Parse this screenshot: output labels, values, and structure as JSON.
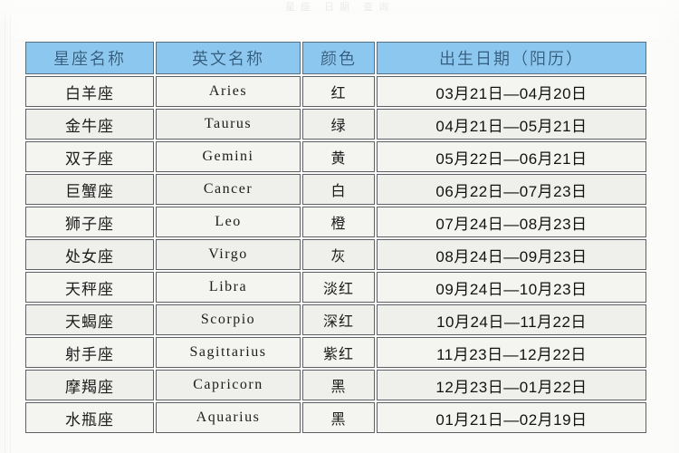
{
  "page": {
    "top_remnant_text": "星座  日期  查询",
    "header_bg_color": "#8cc7ef",
    "header_text_color": "#2f5f84",
    "cell_bg_color": "#f2f2ee",
    "border_color": "#5d6166"
  },
  "table": {
    "columns": [
      {
        "key": "name",
        "label": "星座名称"
      },
      {
        "key": "en",
        "label": "英文名称"
      },
      {
        "key": "color",
        "label": "颜色"
      },
      {
        "key": "date",
        "label": "出生日期（阳历）"
      }
    ],
    "rows": [
      {
        "name": "白羊座",
        "en": "Aries",
        "color": "红",
        "date": "03月21日—04月20日"
      },
      {
        "name": "金牛座",
        "en": "Taurus",
        "color": "绿",
        "date": "04月21日—05月21日"
      },
      {
        "name": "双子座",
        "en": "Gemini",
        "color": "黄",
        "date": "05月22日—06月21日"
      },
      {
        "name": "巨蟹座",
        "en": "Cancer",
        "color": "白",
        "date": "06月22日—07月23日"
      },
      {
        "name": "狮子座",
        "en": "Leo",
        "color": "橙",
        "date": "07月24日—08月23日"
      },
      {
        "name": "处女座",
        "en": "Virgo",
        "color": "灰",
        "date": "08月24日—09月23日"
      },
      {
        "name": "天秤座",
        "en": "Libra",
        "color": "淡红",
        "date": "09月24日—10月23日"
      },
      {
        "name": "天蝎座",
        "en": "Scorpio",
        "color": "深红",
        "date": "10月24日—11月22日"
      },
      {
        "name": "射手座",
        "en": "Sagittarius",
        "color": "紫红",
        "date": "11月23日—12月22日"
      },
      {
        "name": "摩羯座",
        "en": "Capricorn",
        "color": "黑",
        "date": "12月23日—01月22日"
      },
      {
        "name": "水瓶座",
        "en": "Aquarius",
        "color": "黑",
        "date": "01月21日—02月19日"
      }
    ]
  }
}
